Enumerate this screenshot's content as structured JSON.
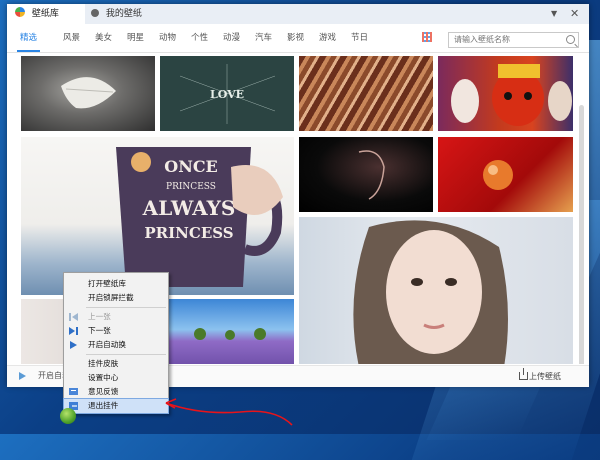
{
  "window": {
    "tabs": [
      {
        "label": "壁纸库",
        "icon": "wallpaper-app-icon"
      },
      {
        "label": "我的壁纸",
        "icon": "user-icon"
      }
    ],
    "controls": {
      "dropdown": "▼",
      "close": "✕"
    }
  },
  "categories": [
    "精选",
    "风景",
    "美女",
    "明星",
    "动物",
    "个性",
    "动漫",
    "汽车",
    "影视",
    "游戏",
    "节日"
  ],
  "active_category": "精选",
  "search": {
    "placeholder": "请输入壁纸名称"
  },
  "thumbnails": [
    {
      "name": "leaf-on-dark",
      "colors": [
        "#3a3a3a",
        "#8a8a88"
      ]
    },
    {
      "name": "love-typography",
      "colors": [
        "#2f4a47",
        "#1f3533"
      ]
    },
    {
      "name": "wood-stripes",
      "colors": [
        "#5a2a1a",
        "#c58b63"
      ]
    },
    {
      "name": "opera-masks",
      "colors": [
        "#c7381d",
        "#3c2f6a"
      ]
    },
    {
      "name": "mug-girl",
      "colors": [
        "#f4f2ef",
        "#7aa3c9"
      ]
    },
    {
      "name": "dark-silhouette",
      "colors": [
        "#050505",
        "#3b2a2a"
      ]
    },
    {
      "name": "red-drop",
      "colors": [
        "#b40d0d",
        "#e8b26a"
      ]
    },
    {
      "name": "portrait-girl",
      "colors": [
        "#d6dde6",
        "#9aa6b2"
      ]
    },
    {
      "name": "lavender-field",
      "colors": [
        "#3a80d0",
        "#8f6bc6"
      ]
    },
    {
      "name": "blurred-light",
      "colors": [
        "#e9e4e1",
        "#c9c2bf"
      ]
    }
  ],
  "mug_text": [
    "ONCE",
    "PRINCESS",
    "ALWAYS",
    "PRINCESS"
  ],
  "love_text": "LOVE",
  "bottom_bar": {
    "autoplay_label": "开启自动换",
    "upload_label": "上传壁纸"
  },
  "context_menu": {
    "items": [
      {
        "label": "打开壁纸库",
        "icon": "",
        "disabled": false
      },
      {
        "label": "开启锁屏拦截",
        "icon": "",
        "disabled": false
      },
      {
        "label": "上一张",
        "icon": "prev-icon",
        "disabled": true
      },
      {
        "label": "下一张",
        "icon": "next-icon",
        "disabled": false
      },
      {
        "label": "开启自动换",
        "icon": "play-icon",
        "disabled": false
      },
      {
        "label": "挂件皮肤",
        "icon": "",
        "disabled": false
      },
      {
        "label": "设置中心",
        "icon": "",
        "disabled": false
      },
      {
        "label": "意见反馈",
        "icon": "feedback-icon",
        "disabled": false
      },
      {
        "label": "退出挂件",
        "icon": "exit-icon",
        "disabled": false,
        "highlighted": true
      }
    ]
  },
  "colors": {
    "accent": "#2b85e4",
    "annotation": "#e8141a"
  }
}
